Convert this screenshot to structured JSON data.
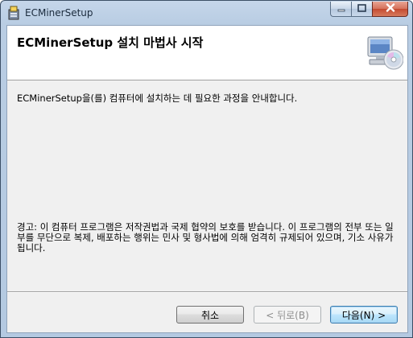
{
  "window": {
    "title": "ECMinerSetup",
    "app_icon": "installer-icon",
    "controls": {
      "minimize_icon": "minimize-icon",
      "maximize_icon": "maximize-icon",
      "close_icon": "close-icon"
    }
  },
  "banner": {
    "title": "ECMinerSetup 설치 마법사 시작",
    "graphic": "computer-cd-icon"
  },
  "content": {
    "intro": "ECMinerSetup을(를) 컴퓨터에 설치하는 데 필요한 과정을 안내합니다.",
    "warning": "경고: 이 컴퓨터 프로그램은 저작권법과 국제 협약의 보호를 받습니다. 이 프로그램의 전부 또는 일부를 무단으로 복제, 배포하는 행위는 민사 및 형사법에 의해 엄격히 규제되어 있으며, 기소 사유가 됩니다."
  },
  "buttons": {
    "cancel": "취소",
    "back": "< 뒤로(B)",
    "next": "다음(N) >"
  }
}
